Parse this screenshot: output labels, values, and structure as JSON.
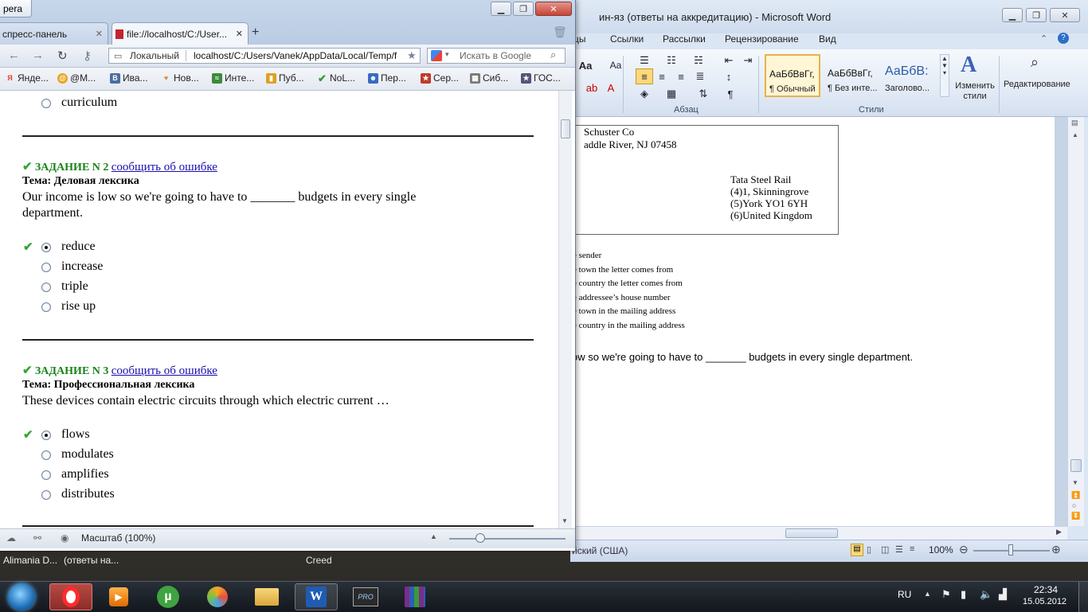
{
  "word": {
    "title": "ин-яз (ответы на аккредитацию)  -  Microsoft Word",
    "tabs": [
      "цы",
      "Ссылки",
      "Рассылки",
      "Рецензирование",
      "Вид"
    ],
    "ribbon": {
      "font_size_label": "Aa",
      "paragraph_label": "Абзац",
      "styles_label": "Стили",
      "styles": [
        {
          "sample": "АаБбВвГг,",
          "name": "¶ Обычный",
          "selected": true
        },
        {
          "sample": "АаБбВвГг,",
          "name": "¶ Без инте...",
          "selected": false
        },
        {
          "sample": "АаБбВ:",
          "name": "Заголово...",
          "selected": false
        }
      ],
      "change_styles_label": "Изменить стили",
      "editing_label": "Редактирование"
    },
    "document": {
      "address_lines": [
        "Schuster Co",
        "addle River, NJ 07458"
      ],
      "recipient_lines": [
        "Tata Steel Rail",
        "(4)1, Skinningrove",
        "(5)York YO1 6YH",
        "(6)United Kingdom"
      ],
      "list_lines": [
        "e sender",
        "e town the letter comes from",
        "e country the letter comes from",
        "e addressee’s house number",
        "e town in the mailing address",
        "e country in the mailing address"
      ],
      "sentence": "ow so we're going to have to _______ budgets in every single department."
    },
    "status": {
      "language": "йский (США)",
      "zoom": "100%"
    }
  },
  "browser": {
    "app_name_fragment": "pera",
    "tabs": [
      {
        "label": "спресс-панель",
        "active": false
      },
      {
        "label": "file://localhost/C:/User...",
        "active": true
      }
    ],
    "address_prefix": "Локальный",
    "address_url": "localhost/C:/Users/Vanek/AppData/Local/Temp/f",
    "search_placeholder": "Искать в Google",
    "bookmarks": [
      {
        "label": "Янде...",
        "icon": "yandex-icon",
        "color": "#e03a2e"
      },
      {
        "label": "@М...",
        "icon": "mail-icon",
        "color": "#2a68c8"
      },
      {
        "label": "Ива...",
        "icon": "vk-icon",
        "color": "#4a6fa0"
      },
      {
        "label": "Нов...",
        "icon": "heart-icon",
        "color": "#d98a3a"
      },
      {
        "label": "Инте...",
        "icon": "globe-icon",
        "color": "#3c8b3c"
      },
      {
        "label": "Пуб...",
        "icon": "bookmark-icon",
        "color": "#e0a020"
      },
      {
        "label": "NoL...",
        "icon": "checkmark-icon",
        "color": "#2f9e2f"
      },
      {
        "label": "Пер...",
        "icon": "people-icon",
        "color": "#3a6ac0"
      },
      {
        "label": "Сер...",
        "icon": "star-icon",
        "color": "#c0392b"
      },
      {
        "label": "Сиб...",
        "icon": "grid-icon",
        "color": "#7a7a7a"
      },
      {
        "label": "ГОС...",
        "icon": "state-icon",
        "color": "#555577"
      }
    ],
    "content": {
      "prev_answer": "curriculum",
      "tasks": [
        {
          "title": "ЗАДАНИЕ N 2",
          "report_link": "сообщить об ошибке",
          "topic": "Тема: Деловая лексика",
          "question_line1": "Our income is low so we're going to have to _______ budgets in every single",
          "question_line2": "department.",
          "answers": [
            {
              "text": "reduce",
              "selected": true
            },
            {
              "text": "increase",
              "selected": false
            },
            {
              "text": "triple",
              "selected": false
            },
            {
              "text": "rise up",
              "selected": false
            }
          ]
        },
        {
          "title": "ЗАДАНИЕ N 3",
          "report_link": "сообщить об ошибке",
          "topic": "Тема: Профессиональная лексика",
          "question_line1": "These devices contain electric circuits through which electric current …",
          "answers": [
            {
              "text": "flows",
              "selected": true
            },
            {
              "text": "modulates",
              "selected": false
            },
            {
              "text": "amplifies",
              "selected": false
            },
            {
              "text": "distributes",
              "selected": false
            }
          ]
        }
      ]
    },
    "status_zoom": "Масштаб (100%)"
  },
  "taskbar": {
    "strip_items": [
      "Alimania D...",
      "(ответы на...",
      "Creed"
    ],
    "apps": [
      "start-orb",
      "opera",
      "media-player",
      "utorrent",
      "paint-app",
      "explorer",
      "word",
      "video-pro",
      "winrar"
    ],
    "tray": {
      "language": "RU",
      "time": "22:34",
      "date": "15.05.2012"
    }
  }
}
